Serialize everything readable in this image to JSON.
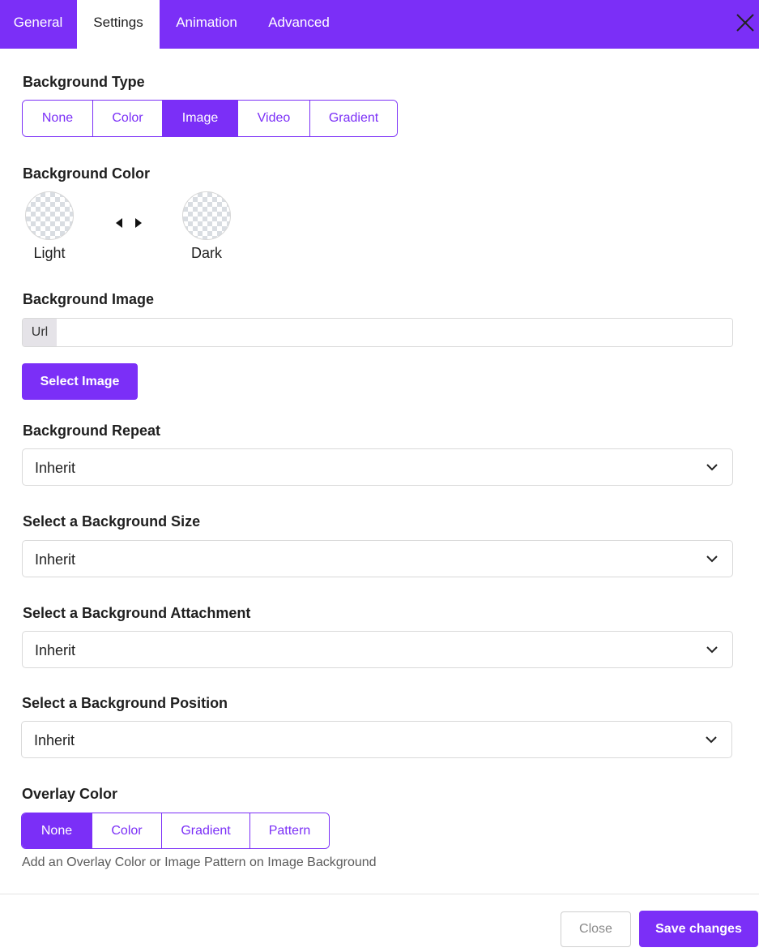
{
  "header": {
    "tabs": [
      {
        "label": "General",
        "active": false
      },
      {
        "label": "Settings",
        "active": true
      },
      {
        "label": "Animation",
        "active": false
      },
      {
        "label": "Advanced",
        "active": false
      }
    ],
    "close_icon": "close-icon"
  },
  "background_type": {
    "label": "Background Type",
    "options": [
      "None",
      "Color",
      "Image",
      "Video",
      "Gradient"
    ],
    "selected": "Image"
  },
  "background_color": {
    "label": "Background Color",
    "light_label": "Light",
    "dark_label": "Dark",
    "swap_icon": "left-right-arrows-icon"
  },
  "background_image": {
    "label": "Background Image",
    "url_addon": "Url",
    "url_value": "",
    "select_button": "Select Image"
  },
  "background_repeat": {
    "label": "Background Repeat",
    "value": "Inherit"
  },
  "background_size": {
    "label": "Select a Background Size",
    "value": "Inherit"
  },
  "background_attachment": {
    "label": "Select a Background Attachment",
    "value": "Inherit"
  },
  "background_position": {
    "label": "Select a Background Position",
    "value": "Inherit"
  },
  "overlay_color": {
    "label": "Overlay Color",
    "options": [
      "None",
      "Color",
      "Gradient",
      "Pattern"
    ],
    "selected": "None",
    "hint": "Add an Overlay Color or Image Pattern on Image Background"
  },
  "footer": {
    "close_label": "Close",
    "save_label": "Save changes"
  },
  "colors": {
    "accent": "#7b2ff7",
    "border": "#d9d9d9"
  }
}
